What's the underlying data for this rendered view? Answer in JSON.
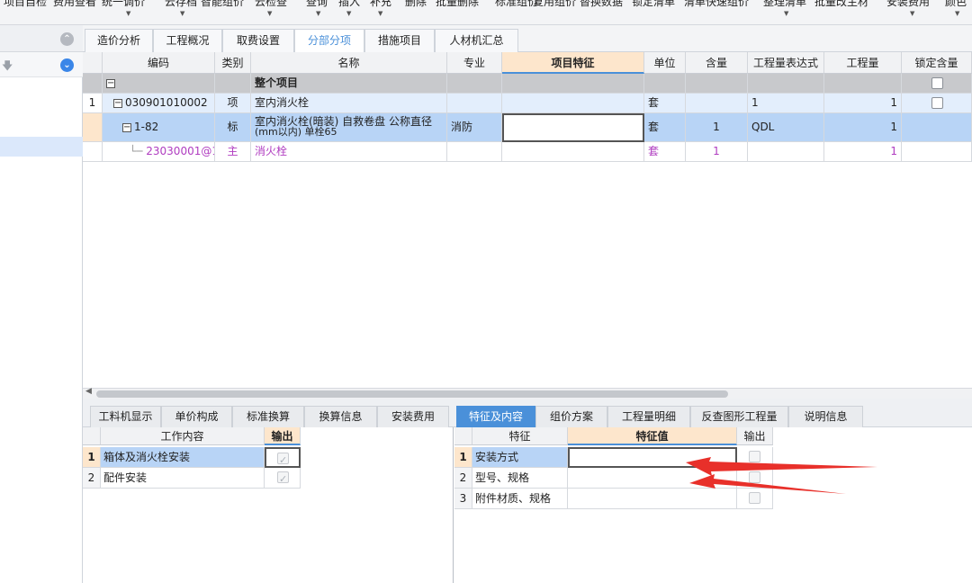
{
  "toolbar": {
    "items": [
      "项目自检",
      "费用查看",
      "统一调价",
      "云存档",
      "智能组价",
      "云检查",
      "查询",
      "插入",
      "补充",
      "删除",
      "批量删除",
      "标准组价",
      "复用组价",
      "替换数据",
      "锁定清单",
      "清单快速组价",
      "整理清单",
      "批量改主材",
      "安装费用",
      "颜色"
    ]
  },
  "sidebar": {
    "collapse_icon": "double-up-arrow-icon",
    "down_icon": "down-arrow-icon",
    "download_icon": "download-circle-icon"
  },
  "top_tabs": [
    "造价分析",
    "工程概况",
    "取费设置",
    "分部分项",
    "措施项目",
    "人材机汇总"
  ],
  "grid": {
    "headers": [
      "编码",
      "类别",
      "名称",
      "专业",
      "项目特征",
      "单位",
      "含量",
      "工程量表达式",
      "工程量",
      "锁定含量"
    ],
    "rows": [
      {
        "no": "",
        "code": "",
        "type": "",
        "name": "整个项目",
        "major": "",
        "feature": "",
        "unit": "",
        "content": "",
        "expr": "",
        "qty": ""
      },
      {
        "no": "1",
        "code": "030901010002",
        "type": "项",
        "name": "室内消火栓",
        "major": "",
        "feature": "",
        "unit": "套",
        "content": "",
        "expr": "1",
        "qty": "1"
      },
      {
        "no": "",
        "code": "1-82",
        "type": "标",
        "name_line1": "室内消火栓(暗装) 自救卷盘 公称直径",
        "name_line2": "(mm以内) 单栓65",
        "major": "消防",
        "feature": "",
        "unit": "套",
        "content": "1",
        "expr": "QDL",
        "qty": "1"
      },
      {
        "no": "",
        "code": "23030001@1",
        "type": "主",
        "name": "消火栓",
        "major": "",
        "feature": "",
        "unit": "套",
        "content": "1",
        "expr": "",
        "qty": "1"
      }
    ]
  },
  "bottom_tabs": [
    "工料机显示",
    "单价构成",
    "标准换算",
    "换算信息",
    "安装费用",
    "特征及内容",
    "组价方案",
    "工程量明细",
    "反查图形工程量",
    "说明信息"
  ],
  "work_content": {
    "headers": [
      "工作内容",
      "输出"
    ],
    "rows": [
      {
        "no": "1",
        "text": "箱体及消火栓安装",
        "checked": true
      },
      {
        "no": "2",
        "text": "配件安装",
        "checked": true
      }
    ]
  },
  "features": {
    "headers": [
      "特征",
      "特征值",
      "输出"
    ],
    "rows": [
      {
        "no": "1",
        "name": "安装方式",
        "value": ""
      },
      {
        "no": "2",
        "name": "型号、规格",
        "value": ""
      },
      {
        "no": "3",
        "name": "附件材质、规格",
        "value": ""
      }
    ]
  },
  "colors": {
    "accent": "#4a90d9",
    "header_highlight": "#fde6cc",
    "selected_row": "#b8d4f6",
    "annotation_arrow": "#e8302a",
    "sub_item_text": "#b03cc0"
  }
}
